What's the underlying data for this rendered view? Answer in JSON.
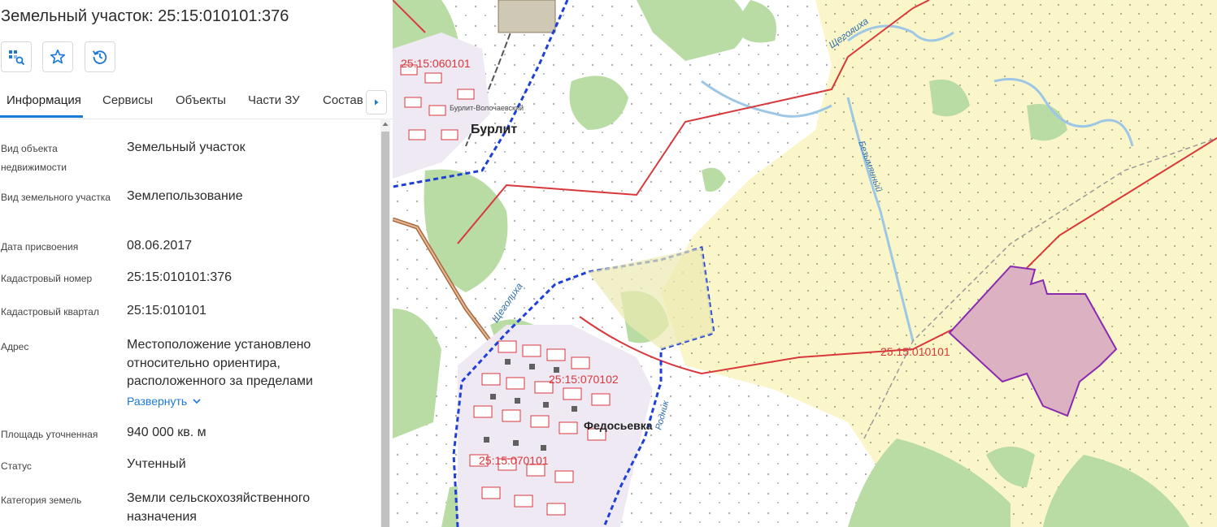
{
  "header": {
    "title": "Земельный участок: 25:15:010101:376"
  },
  "toolbar": {
    "buttons": [
      {
        "name": "locate-button",
        "icon": "locate-parcel-icon"
      },
      {
        "name": "favorite-button",
        "icon": "star-icon"
      },
      {
        "name": "history-button",
        "icon": "history-icon"
      }
    ]
  },
  "tabs": {
    "active": "Информация",
    "items": [
      {
        "label": "Информация"
      },
      {
        "label": "Сервисы"
      },
      {
        "label": "Объекты"
      },
      {
        "label": "Части ЗУ"
      },
      {
        "label": "Состав"
      }
    ]
  },
  "info": {
    "rows": [
      {
        "label": "Вид объекта недвижимости",
        "value": "Земельный участок"
      },
      {
        "label": "Вид земельного участка",
        "value": "Землепользование"
      },
      {
        "label": "Дата присвоения",
        "value": "08.06.2017"
      },
      {
        "label": "Кадастровый номер",
        "value": "25:15:010101:376"
      },
      {
        "label": "Кадастровый квартал",
        "value": "25:15:010101"
      },
      {
        "label": "Адрес",
        "value": "Местоположение установлено относительно ориентира, расположенного за пределами"
      },
      {
        "label": "Площадь уточненная",
        "value": "940 000 кв. м"
      },
      {
        "label": "Статус",
        "value": "Учтенный"
      },
      {
        "label": "Категория земель",
        "value": "Земли сельскохозяйственного назначения"
      }
    ],
    "expand_label": "Развернуть"
  },
  "map": {
    "labels": {
      "burlit": "Бурлит",
      "burlit_small": "Бурлит-Волочаевский",
      "fedosevka": "Федосьевка",
      "q060101": "25:15:060101",
      "q010101": "25:15:010101",
      "q070102": "25:15:070102",
      "q070101": "25:15:070101",
      "river1": "Щеголиха",
      "river2": "Щеголиха",
      "river3": "Безымянный",
      "river4": "Родник"
    },
    "colors": {
      "field": "#fbf6c9",
      "forest": "#b9dca4",
      "boundary_red": "#d8383c",
      "boundary_blue": "#1e40d8",
      "parcel_fill": "#dcb1c2",
      "parcel_stroke": "#8a2ab0",
      "river": "#9ec7e6"
    }
  },
  "colors": {
    "accent": "#1b79d8"
  }
}
